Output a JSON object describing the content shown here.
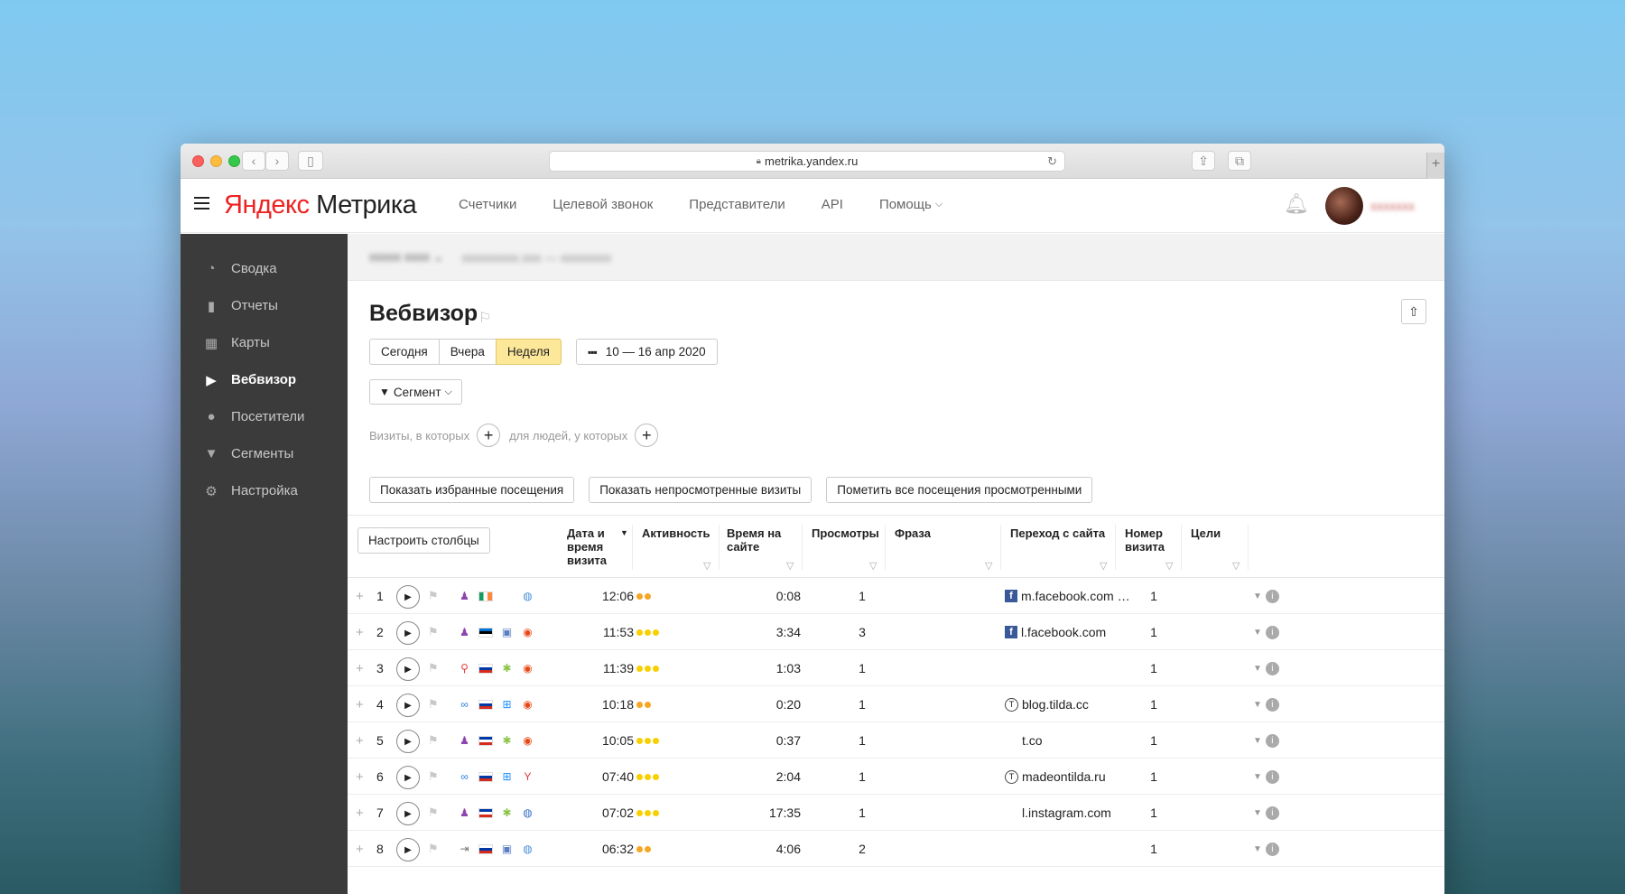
{
  "browser": {
    "url": "metrika.yandex.ru",
    "back_icon": "chevron-left-icon",
    "forward_icon": "chevron-right-icon"
  },
  "header": {
    "logo_ya": "Яндекс",
    "logo_product": "Метрика",
    "nav": [
      {
        "label": "Счетчики"
      },
      {
        "label": "Целевой звонок"
      },
      {
        "label": "Представители"
      },
      {
        "label": "API"
      },
      {
        "label": "Помощь"
      }
    ]
  },
  "sidebar": {
    "items": [
      {
        "label": "Сводка",
        "icon": "gauge-icon",
        "active": false
      },
      {
        "label": "Отчеты",
        "icon": "bar-chart-icon",
        "active": false
      },
      {
        "label": "Карты",
        "icon": "map-grid-icon",
        "active": false
      },
      {
        "label": "Вебвизор",
        "icon": "play-icon",
        "active": true
      },
      {
        "label": "Посетители",
        "icon": "user-icon",
        "active": false
      },
      {
        "label": "Сегменты",
        "icon": "filter-icon",
        "active": false
      },
      {
        "label": "Настройка",
        "icon": "gear-icon",
        "active": false
      }
    ]
  },
  "page": {
    "title": "Вебвизор",
    "period": {
      "options": [
        "Сегодня",
        "Вчера",
        "Неделя"
      ],
      "selected": "Неделя",
      "date_range": "10 — 16 апр 2020"
    },
    "segment_label": "Сегмент",
    "filter": {
      "visits_label": "Визиты, в которых",
      "people_label": "для людей, у которых"
    },
    "actions": {
      "favorites": "Показать избранные посещения",
      "unviewed": "Показать непросмотренные визиты",
      "mark_all": "Пометить все посещения просмотренными"
    },
    "table": {
      "config_columns": "Настроить столбцы",
      "columns": {
        "datetime": "Дата и время визита",
        "activity": "Активность",
        "duration": "Время на сайте",
        "views": "Просмотры",
        "phrase": "Фраза",
        "referrer": "Переход с сайта",
        "visit_num": "Номер визита",
        "goals": "Цели"
      },
      "rows": [
        {
          "n": "1",
          "time": "12:06",
          "activity": 2,
          "duration": "0:08",
          "views": "1",
          "ref_icon": "facebook",
          "referrer": "m.facebook.com …",
          "visit": "1",
          "source": "person",
          "flag": [
            "#169b62",
            "#ffffff",
            "#ff883e"
          ],
          "os": "apple",
          "browser": "safari"
        },
        {
          "n": "2",
          "time": "11:53",
          "activity": 3,
          "duration": "3:34",
          "views": "3",
          "ref_icon": "facebook",
          "referrer": "l.facebook.com",
          "visit": "1",
          "source": "person",
          "flag": [
            "#0072ce",
            "#000000",
            "#ffffff"
          ],
          "os": "mac",
          "browser": "chrome"
        },
        {
          "n": "3",
          "time": "11:39",
          "activity": 3,
          "duration": "1:03",
          "views": "1",
          "ref_icon": "",
          "referrer": "",
          "visit": "1",
          "source": "search",
          "flag": [
            "#ffffff",
            "#0039a6",
            "#d52b1e"
          ],
          "os": "android",
          "browser": "chrome"
        },
        {
          "n": "4",
          "time": "10:18",
          "activity": 2,
          "duration": "0:20",
          "views": "1",
          "ref_icon": "tilda",
          "referrer": "blog.tilda.cc",
          "visit": "1",
          "source": "link",
          "flag": [
            "#ffffff",
            "#0039a6",
            "#d52b1e"
          ],
          "os": "windows",
          "browser": "chrome"
        },
        {
          "n": "5",
          "time": "10:05",
          "activity": 3,
          "duration": "0:37",
          "views": "1",
          "ref_icon": "",
          "referrer": "t.co",
          "visit": "1",
          "source": "person",
          "flag": [
            "#0039a6",
            "#ffffff",
            "#d52b1e"
          ],
          "os": "android",
          "browser": "chrome"
        },
        {
          "n": "6",
          "time": "07:40",
          "activity": 3,
          "duration": "2:04",
          "views": "1",
          "ref_icon": "tilda",
          "referrer": "madeontilda.ru",
          "visit": "1",
          "source": "link",
          "flag": [
            "#ffffff",
            "#0039a6",
            "#d52b1e"
          ],
          "os": "windows",
          "browser": "yandex"
        },
        {
          "n": "7",
          "time": "07:02",
          "activity": 3,
          "duration": "17:35",
          "views": "1",
          "ref_icon": "",
          "referrer": "l.instagram.com",
          "visit": "1",
          "source": "person",
          "flag": [
            "#0039a6",
            "#ffffff",
            "#d52b1e"
          ],
          "os": "android",
          "browser": "globe"
        },
        {
          "n": "8",
          "time": "06:32",
          "activity": 2,
          "duration": "4:06",
          "views": "2",
          "ref_icon": "",
          "referrer": "",
          "visit": "1",
          "source": "enter",
          "flag": [
            "#ffffff",
            "#0039a6",
            "#d52b1e"
          ],
          "os": "mac",
          "browser": "safari"
        }
      ]
    }
  },
  "colors": {
    "accent_yellow": "#fde89a",
    "dot_orange": "#f5a623",
    "dot_yellow": "#f8d000",
    "sidebar_bg": "#3b3b3b",
    "logo_red": "#ee2222"
  }
}
